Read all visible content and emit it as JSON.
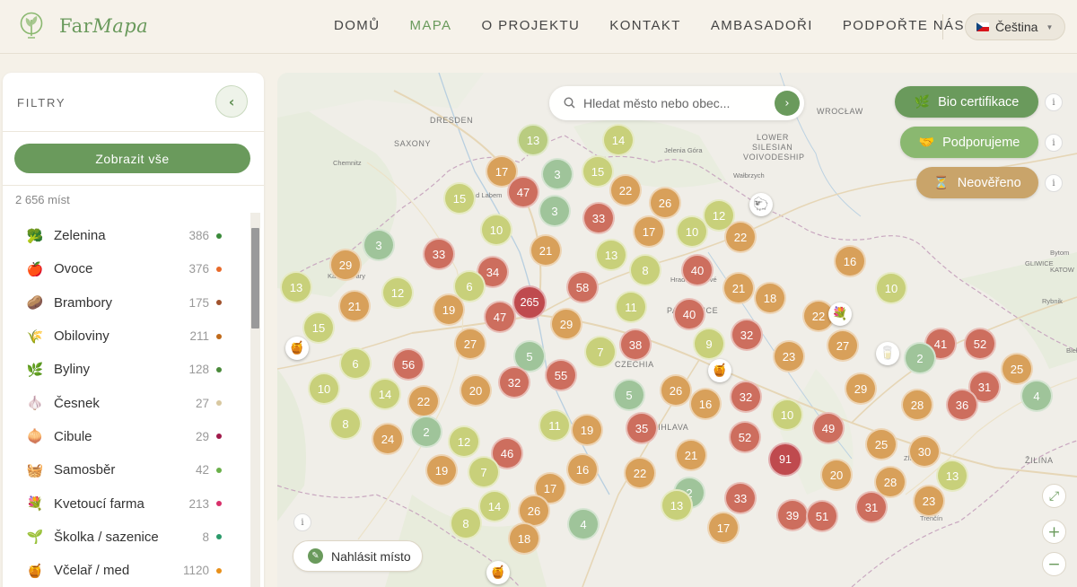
{
  "header": {
    "logo_text_a": "Far",
    "logo_text_b": "Mapa",
    "nav": [
      "DOMŮ",
      "MAPA",
      "O PROJEKTU",
      "KONTAKT",
      "AMBASADOŘI",
      "PODPOŘTE NÁS"
    ],
    "active_nav": "MAPA",
    "language": "Čeština",
    "accent_color": "#6a9a5c"
  },
  "sidebar": {
    "title": "FILTRY",
    "collapse_icon": "chevron-left-icon",
    "show_all_label": "Zobrazit vše",
    "total_count": "2 656 míst",
    "categories": [
      {
        "icon": "🥦",
        "icon_name": "broccoli-icon",
        "name": "Zelenina",
        "count": "386",
        "color": "#3a8a3a"
      },
      {
        "icon": "🍎",
        "icon_name": "apple-icon",
        "name": "Ovoce",
        "count": "376",
        "color": "#e86a2a"
      },
      {
        "icon": "🥔",
        "icon_name": "potato-icon",
        "name": "Brambory",
        "count": "175",
        "color": "#a0522d"
      },
      {
        "icon": "🌾",
        "icon_name": "wheat-icon",
        "name": "Obiloviny",
        "count": "211",
        "color": "#c06a1a"
      },
      {
        "icon": "🌿",
        "icon_name": "herb-icon",
        "name": "Byliny",
        "count": "128",
        "color": "#4a8a3a"
      },
      {
        "icon": "🧄",
        "icon_name": "garlic-icon",
        "name": "Česnek",
        "count": "27",
        "color": "#d8c8a0"
      },
      {
        "icon": "🧅",
        "icon_name": "onion-icon",
        "name": "Cibule",
        "count": "29",
        "color": "#a01a4a"
      },
      {
        "icon": "🧺",
        "icon_name": "basket-icon",
        "name": "Samosběr",
        "count": "42",
        "color": "#6ab04a"
      },
      {
        "icon": "💐",
        "icon_name": "flower-icon",
        "name": "Kvetoucí farma",
        "count": "213",
        "color": "#d8306a"
      },
      {
        "icon": "🌱",
        "icon_name": "seedling-icon",
        "name": "Školka / sazenice",
        "count": "8",
        "color": "#2a9a6a"
      },
      {
        "icon": "🍯",
        "icon_name": "honey-icon",
        "name": "Včelař / med",
        "count": "1120",
        "color": "#e8901a"
      }
    ]
  },
  "map": {
    "search_placeholder": "Hledat město nebo obec...",
    "pills": [
      {
        "label": "Bio certifikace",
        "icon": "🌿",
        "icon_name": "leaf-icon",
        "color": "#6a9a5c"
      },
      {
        "label": "Podporujeme",
        "icon": "🤝",
        "icon_name": "handshake-icon",
        "color": "#8ab870"
      },
      {
        "label": "Neověřeno",
        "icon": "⏳",
        "icon_name": "hourglass-icon",
        "color": "#c9a46a"
      }
    ],
    "info_label": "i",
    "report_label": "Nahlásit místo",
    "labels": [
      "DRESDEN",
      "SAXONY",
      "Chemnitz",
      "ad Labem",
      "Jelenia Góra",
      "LOWER",
      "SILESIAN",
      "VOIVODESHIP",
      "Wałbrzych",
      "WROCŁAW",
      "GLIWICE",
      "Bytom",
      "KATOW",
      "Rybnik",
      "Bielsko",
      "CZECHIA",
      "Hradec Králové",
      "PARDUBICE",
      "Karlovy Vary",
      "JIHLAVA",
      "ŽILINA",
      "Trenčín",
      "Zlín"
    ],
    "clusters": [
      {
        "v": "13",
        "t": "g"
      },
      {
        "v": "14",
        "t": "y"
      },
      {
        "v": "17",
        "t": "o"
      },
      {
        "v": "3",
        "t": "l"
      },
      {
        "v": "15",
        "t": "y"
      },
      {
        "v": "47",
        "t": "r"
      },
      {
        "v": "22",
        "t": "o"
      },
      {
        "v": "26",
        "t": "o"
      },
      {
        "v": "15",
        "t": "y"
      },
      {
        "v": "3",
        "t": "l"
      },
      {
        "v": "33",
        "t": "r"
      },
      {
        "v": "12",
        "t": "y"
      },
      {
        "v": "10",
        "t": "y"
      },
      {
        "v": "21",
        "t": "o"
      },
      {
        "v": "17",
        "t": "o"
      },
      {
        "v": "10",
        "t": "y"
      },
      {
        "v": "22",
        "t": "o"
      },
      {
        "v": "3",
        "t": "l"
      },
      {
        "v": "33",
        "t": "r"
      },
      {
        "v": "13",
        "t": "y"
      },
      {
        "v": "29",
        "t": "o"
      },
      {
        "v": "34",
        "t": "r"
      },
      {
        "v": "8",
        "t": "y"
      },
      {
        "v": "40",
        "t": "r"
      },
      {
        "v": "16",
        "t": "o"
      },
      {
        "v": "13",
        "t": "y"
      },
      {
        "v": "6",
        "t": "y"
      },
      {
        "v": "21",
        "t": "o"
      },
      {
        "v": "12",
        "t": "y"
      },
      {
        "v": "265",
        "t": "d"
      },
      {
        "v": "58",
        "t": "r"
      },
      {
        "v": "18",
        "t": "o"
      },
      {
        "v": "10",
        "t": "y"
      },
      {
        "v": "21",
        "t": "o"
      },
      {
        "v": "19",
        "t": "o"
      },
      {
        "v": "11",
        "t": "y"
      },
      {
        "v": "47",
        "t": "r"
      },
      {
        "v": "40",
        "t": "r"
      },
      {
        "v": "22",
        "t": "o"
      },
      {
        "v": "15",
        "t": "y"
      },
      {
        "v": "29",
        "t": "o"
      },
      {
        "v": "27",
        "t": "o"
      },
      {
        "v": "32",
        "t": "r"
      },
      {
        "v": "41",
        "t": "r"
      },
      {
        "v": "52",
        "t": "r"
      },
      {
        "v": "7",
        "t": "y"
      },
      {
        "v": "38",
        "t": "r"
      },
      {
        "v": "9",
        "t": "y"
      },
      {
        "v": "27",
        "t": "o"
      },
      {
        "v": "23",
        "t": "o"
      },
      {
        "v": "2",
        "t": "l"
      },
      {
        "v": "5",
        "t": "l"
      },
      {
        "v": "25",
        "t": "o"
      },
      {
        "v": "6",
        "t": "y"
      },
      {
        "v": "56",
        "t": "r"
      },
      {
        "v": "55",
        "t": "r"
      },
      {
        "v": "31",
        "t": "r"
      },
      {
        "v": "10",
        "t": "y"
      },
      {
        "v": "14",
        "t": "y"
      },
      {
        "v": "20",
        "t": "o"
      },
      {
        "v": "32",
        "t": "r"
      },
      {
        "v": "26",
        "t": "o"
      },
      {
        "v": "29",
        "t": "o"
      },
      {
        "v": "4",
        "t": "l"
      },
      {
        "v": "22",
        "t": "o"
      },
      {
        "v": "5",
        "t": "l"
      },
      {
        "v": "16",
        "t": "o"
      },
      {
        "v": "32",
        "t": "r"
      },
      {
        "v": "36",
        "t": "r"
      },
      {
        "v": "28",
        "t": "o"
      },
      {
        "v": "10",
        "t": "y"
      },
      {
        "v": "8",
        "t": "y"
      },
      {
        "v": "11",
        "t": "y"
      },
      {
        "v": "35",
        "t": "r"
      },
      {
        "v": "49",
        "t": "r"
      },
      {
        "v": "19",
        "t": "o"
      },
      {
        "v": "24",
        "t": "o"
      },
      {
        "v": "2",
        "t": "l"
      },
      {
        "v": "52",
        "t": "r"
      },
      {
        "v": "12",
        "t": "y"
      },
      {
        "v": "25",
        "t": "o"
      },
      {
        "v": "30",
        "t": "o"
      },
      {
        "v": "21",
        "t": "o"
      },
      {
        "v": "46",
        "t": "r"
      },
      {
        "v": "91",
        "t": "d"
      },
      {
        "v": "19",
        "t": "o"
      },
      {
        "v": "7",
        "t": "y"
      },
      {
        "v": "16",
        "t": "o"
      },
      {
        "v": "22",
        "t": "o"
      },
      {
        "v": "20",
        "t": "o"
      },
      {
        "v": "13",
        "t": "y"
      },
      {
        "v": "17",
        "t": "o"
      },
      {
        "v": "2",
        "t": "l"
      },
      {
        "v": "28",
        "t": "o"
      },
      {
        "v": "14",
        "t": "y"
      },
      {
        "v": "26",
        "t": "o"
      },
      {
        "v": "33",
        "t": "r"
      },
      {
        "v": "23",
        "t": "o"
      },
      {
        "v": "13",
        "t": "y"
      },
      {
        "v": "8",
        "t": "y"
      },
      {
        "v": "4",
        "t": "l"
      },
      {
        "v": "31",
        "t": "r"
      },
      {
        "v": "39",
        "t": "r"
      },
      {
        "v": "51",
        "t": "r"
      },
      {
        "v": "17",
        "t": "o"
      },
      {
        "v": "18",
        "t": "o"
      }
    ],
    "markers": [
      {
        "icon": "🍯",
        "name": "honey-marker-icon"
      },
      {
        "icon": "🐑",
        "name": "sheep-marker-icon"
      },
      {
        "icon": "💐",
        "name": "flower-marker-icon"
      },
      {
        "icon": "🍯",
        "name": "honey-marker-icon"
      },
      {
        "icon": "🥛",
        "name": "milk-marker-icon"
      },
      {
        "icon": "🍯",
        "name": "honey-marker-icon"
      }
    ],
    "controls": {
      "fullscreen": "⤢",
      "zoom_in": "+",
      "zoom_out": "−"
    }
  }
}
